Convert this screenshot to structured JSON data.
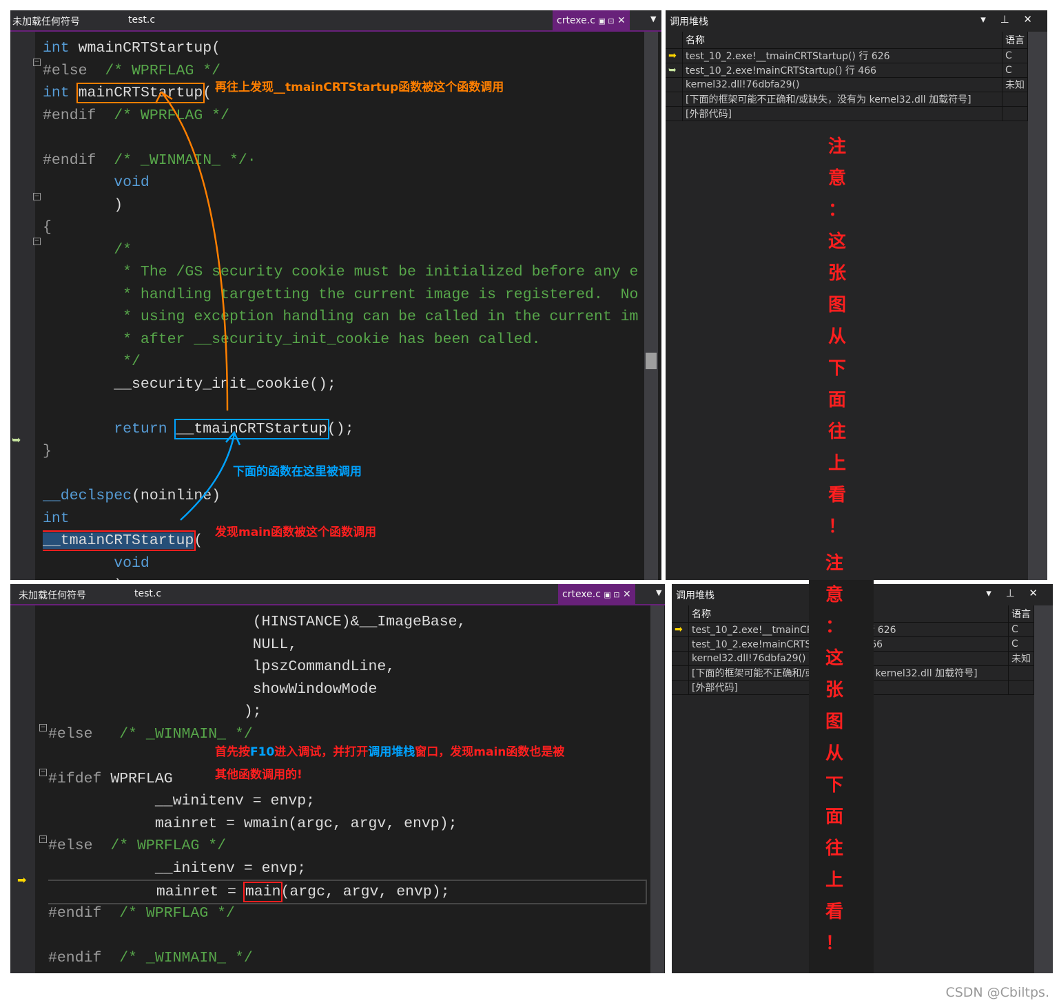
{
  "colors": {
    "accent": "#68217a",
    "orange": "#ff7f00",
    "blue": "#00a2ff",
    "red": "#ff1f1f"
  },
  "top": {
    "tabs": {
      "symbols": "未加载任何符号",
      "test": "test.c",
      "active": "crtexe.c"
    },
    "code": [
      [
        [
          "int",
          "kw"
        ],
        [
          " wmainCRTStartup(",
          ""
        ]
      ],
      [
        [
          "#else  ",
          "pp"
        ],
        [
          "/* WPRFLAG */",
          "cm"
        ]
      ],
      [
        [
          "int",
          "kw"
        ],
        [
          " ",
          ""
        ],
        [
          "mainCRTStartup",
          "box-o"
        ],
        [
          "(",
          ""
        ]
      ],
      [
        [
          "#endif  ",
          "pp"
        ],
        [
          "/* WPRFLAG */",
          "cm"
        ]
      ],
      [],
      [
        [
          "#endif  ",
          "pp"
        ],
        [
          "/* _WINMAIN_ */·",
          "cm"
        ]
      ],
      [
        [
          "        ",
          ""
        ],
        [
          "void",
          "kw"
        ]
      ],
      [
        [
          "        )",
          ""
        ]
      ],
      [
        [
          "{",
          "br"
        ]
      ],
      [
        [
          "        /*",
          "cm"
        ]
      ],
      [
        [
          "         * The /GS security cookie must be initialized before any e",
          "cm"
        ]
      ],
      [
        [
          "         * handling targetting the current image is registered.  No",
          "cm"
        ]
      ],
      [
        [
          "         * using exception handling can be called in the current im",
          "cm"
        ]
      ],
      [
        [
          "         * after __security_init_cookie has been called.",
          "cm"
        ]
      ],
      [
        [
          "         */",
          "cm"
        ]
      ],
      [
        [
          "        __security_init_cookie();",
          ""
        ]
      ],
      [],
      [
        [
          "        ",
          ""
        ],
        [
          "return",
          "kw"
        ],
        [
          " ",
          ""
        ],
        [
          "__tmainCRTStartup",
          "box-b"
        ],
        [
          "();",
          ""
        ]
      ],
      [
        [
          "}",
          "br"
        ]
      ],
      [],
      [
        [
          "__declspec",
          "kw"
        ],
        [
          "(noinline)",
          ""
        ]
      ],
      [
        [
          "int",
          "kw"
        ]
      ],
      [
        [
          "__tmainCRTStartup",
          "box-r sel"
        ],
        [
          "(",
          ""
        ]
      ],
      [
        [
          "        ",
          ""
        ],
        [
          "void",
          "kw"
        ]
      ],
      [
        [
          "        )",
          ""
        ]
      ]
    ],
    "annotations": {
      "up": "再往上发现__tmainCRTStartup函数被这个函数调用",
      "below": "下面的函数在这里被调用",
      "main": "发现main函数被这个函数调用"
    },
    "callstack": {
      "title": "调用堆栈",
      "col_name": "名称",
      "col_lang": "语言",
      "rows": [
        {
          "name": "test_10_2.exe!__tmainCRTStartup() 行 626",
          "lang": "C",
          "icon": "current-arrow"
        },
        {
          "name": "test_10_2.exe!mainCRTStartup() 行 466",
          "lang": "C",
          "icon": "return-arrow"
        },
        {
          "name": "kernel32.dll!76dbfa29()",
          "lang": "未知",
          "icon": ""
        },
        {
          "name": "[下面的框架可能不正确和/或缺失，没有为 kernel32.dll 加载符号]",
          "lang": "",
          "icon": ""
        },
        {
          "name": "[外部代码]",
          "lang": "",
          "icon": ""
        }
      ]
    }
  },
  "bottom": {
    "tabs": {
      "symbols": "未加载任何符号",
      "test": "test.c",
      "active": "crtexe.c"
    },
    "code": [
      [
        [
          "                       (HINSTANCE)&__ImageBase,",
          ""
        ]
      ],
      [
        [
          "                       NULL,",
          ""
        ]
      ],
      [
        [
          "                       lpszCommandLine,",
          ""
        ]
      ],
      [
        [
          "                       showWindowMode",
          ""
        ]
      ],
      [
        [
          "                      );",
          ""
        ]
      ],
      [
        [
          "#else   ",
          "pp"
        ],
        [
          "/* _WINMAIN_ */",
          "cm"
        ]
      ],
      [],
      [
        [
          "#ifdef ",
          "pp"
        ],
        [
          "WPRFLAG",
          ""
        ]
      ],
      [
        [
          "            __winitenv = envp;",
          ""
        ]
      ],
      [
        [
          "            mainret = wmain(argc, argv, envp);",
          ""
        ]
      ],
      [
        [
          "#else  ",
          "pp"
        ],
        [
          "/* WPRFLAG */",
          "cm"
        ]
      ],
      [
        [
          "            __initenv = envp;",
          ""
        ]
      ],
      [
        [
          "            mainret = ",
          ""
        ],
        [
          "main",
          "box-r"
        ],
        [
          "(argc, argv, envp);",
          ""
        ]
      ],
      [
        [
          "#endif  ",
          "pp"
        ],
        [
          "/* WPRFLAG */",
          "cm"
        ]
      ],
      [],
      [
        [
          "#endif  ",
          "pp"
        ],
        [
          "/* _WINMAIN_ */",
          "cm"
        ]
      ]
    ],
    "annotation": {
      "p1": "首先按",
      "f10": "F10",
      "p2": "进入调试，并打开",
      "cs": "调用堆栈",
      "p3": "窗口，发现main函数也是被",
      "p4": "其他函数调用的!"
    },
    "callstack": {
      "title": "调用堆栈",
      "col_name": "名称",
      "col_lang": "语言",
      "rows": [
        {
          "name": "test_10_2.exe!__tmainCRTStartup() 行 626",
          "lang": "C",
          "icon": "current-arrow"
        },
        {
          "name": "test_10_2.exe!mainCRTStartup() 行 466",
          "lang": "C",
          "icon": ""
        },
        {
          "name": "kernel32.dll!76dbfa29()",
          "lang": "未知",
          "icon": ""
        },
        {
          "name": "[下面的框架可能不正确和/或缺失，没有为 kernel32.dll 加载符号]",
          "lang": "",
          "icon": ""
        },
        {
          "name": "[外部代码]",
          "lang": "",
          "icon": ""
        }
      ]
    }
  },
  "note": [
    "注",
    "意",
    "：",
    "这",
    "张",
    "图",
    "从",
    "下",
    "面",
    "往",
    "上",
    "看",
    "！"
  ],
  "watermark": "CSDN @Cbiltps."
}
